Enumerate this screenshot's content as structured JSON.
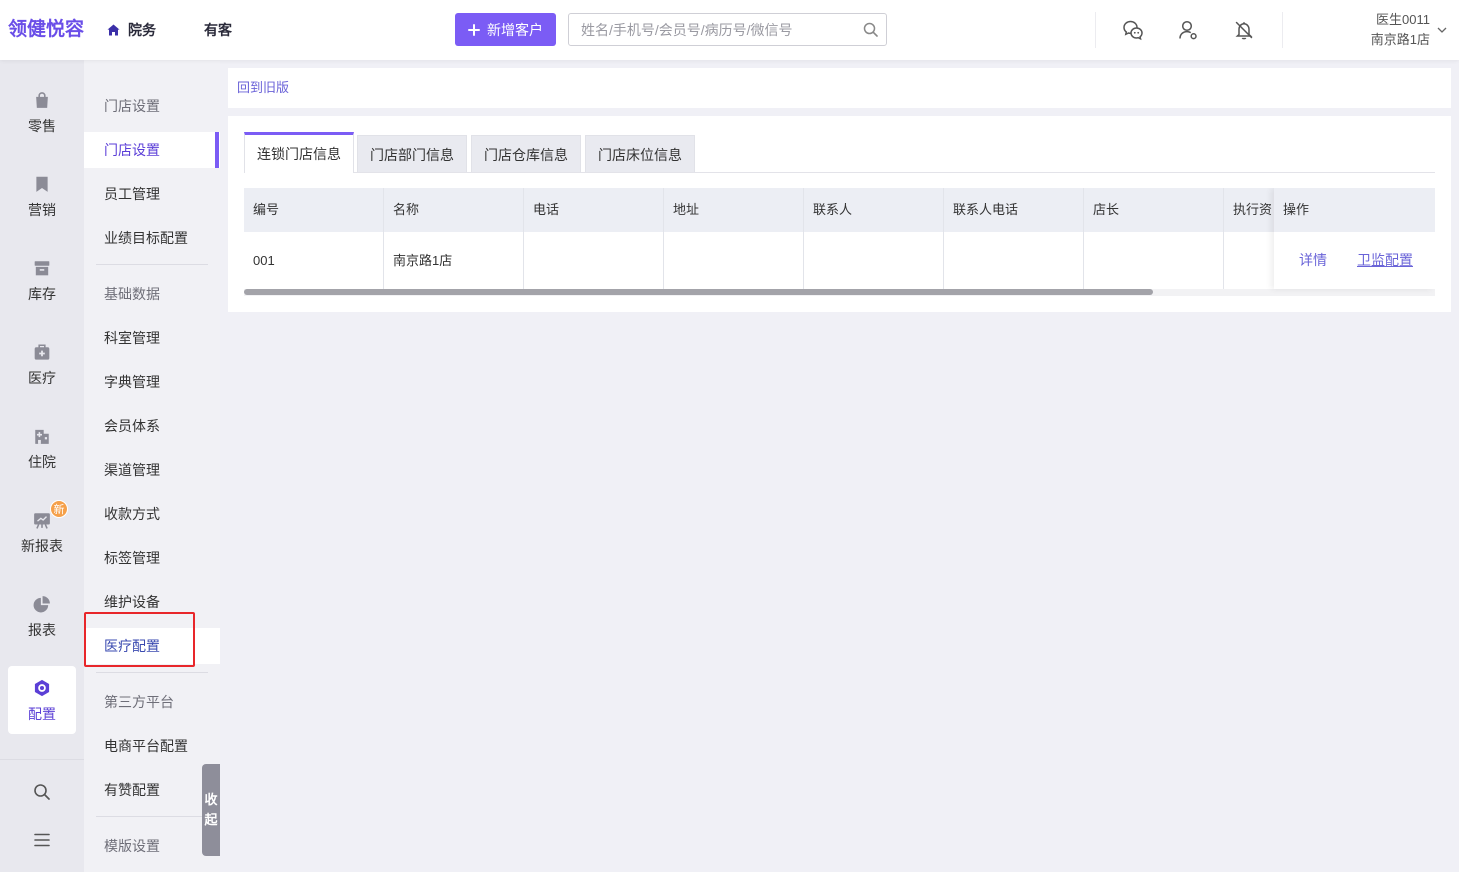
{
  "app": {
    "logo": "领健悦容"
  },
  "header": {
    "nav": [
      {
        "label": "院务",
        "icon": "home-icon",
        "active": true
      },
      {
        "label": "有客"
      }
    ],
    "new_customer_label": "新增客户",
    "search_placeholder": "姓名/手机号/会员号/病历号/微信号",
    "icons": [
      "search-icon",
      "chat-icon",
      "user-icon",
      "bell-off-icon",
      "chevron-down-icon"
    ],
    "user": {
      "name": "医生0011",
      "store": "南京路1店"
    }
  },
  "main_nav": {
    "items": [
      {
        "label": "零售",
        "icon": "shopping-bag-icon"
      },
      {
        "label": "营销",
        "icon": "bookmark-icon"
      },
      {
        "label": "库存",
        "icon": "archive-box-icon"
      },
      {
        "label": "医疗",
        "icon": "medical-kit-icon"
      },
      {
        "label": "住院",
        "icon": "hospital-icon"
      },
      {
        "label": "新报表",
        "icon": "presentation-icon",
        "badge": "新"
      },
      {
        "label": "报表",
        "icon": "pie-chart-icon"
      },
      {
        "label": "配置",
        "icon": "settings-hexagon-icon",
        "active": true
      }
    ],
    "bottom_icons": [
      "search-icon",
      "menu-icon"
    ]
  },
  "sub_nav": {
    "groups": [
      {
        "title": "门店设置",
        "items": [
          {
            "label": "门店设置",
            "active": true
          },
          {
            "label": "员工管理"
          },
          {
            "label": "业绩目标配置"
          }
        ]
      },
      {
        "title": "基础数据",
        "items": [
          {
            "label": "科室管理"
          },
          {
            "label": "字典管理"
          },
          {
            "label": "会员体系"
          },
          {
            "label": "渠道管理"
          },
          {
            "label": "收款方式"
          },
          {
            "label": "标签管理"
          },
          {
            "label": "维护设备"
          },
          {
            "label": "医疗配置",
            "highlighted": true
          }
        ]
      },
      {
        "title": "第三方平台",
        "items": [
          {
            "label": "电商平台配置"
          },
          {
            "label": "有赞配置"
          }
        ]
      },
      {
        "title": "模版设置",
        "items": []
      }
    ],
    "collapse_label": "收起"
  },
  "content": {
    "back_link": "回到旧版",
    "tabs": [
      {
        "label": "连锁门店信息",
        "active": true
      },
      {
        "label": "门店部门信息"
      },
      {
        "label": "门店仓库信息"
      },
      {
        "label": "门店床位信息"
      }
    ],
    "table": {
      "columns": [
        "编号",
        "名称",
        "电话",
        "地址",
        "联系人",
        "联系人电话",
        "店长",
        "执行资"
      ],
      "action_column": "操作",
      "rows": [
        {
          "cells": [
            "001",
            "南京路1店",
            "",
            "",
            "",
            "",
            "",
            ""
          ],
          "actions": [
            "详情",
            "卫监配置"
          ]
        }
      ]
    }
  },
  "colors": {
    "accent": "#7b5cf5",
    "logo": "#6a4ee8",
    "active_nav": "#5b3fd6",
    "link": "#6a64d8",
    "badge": "#f5a04a",
    "highlight_box": "#e8262a"
  }
}
